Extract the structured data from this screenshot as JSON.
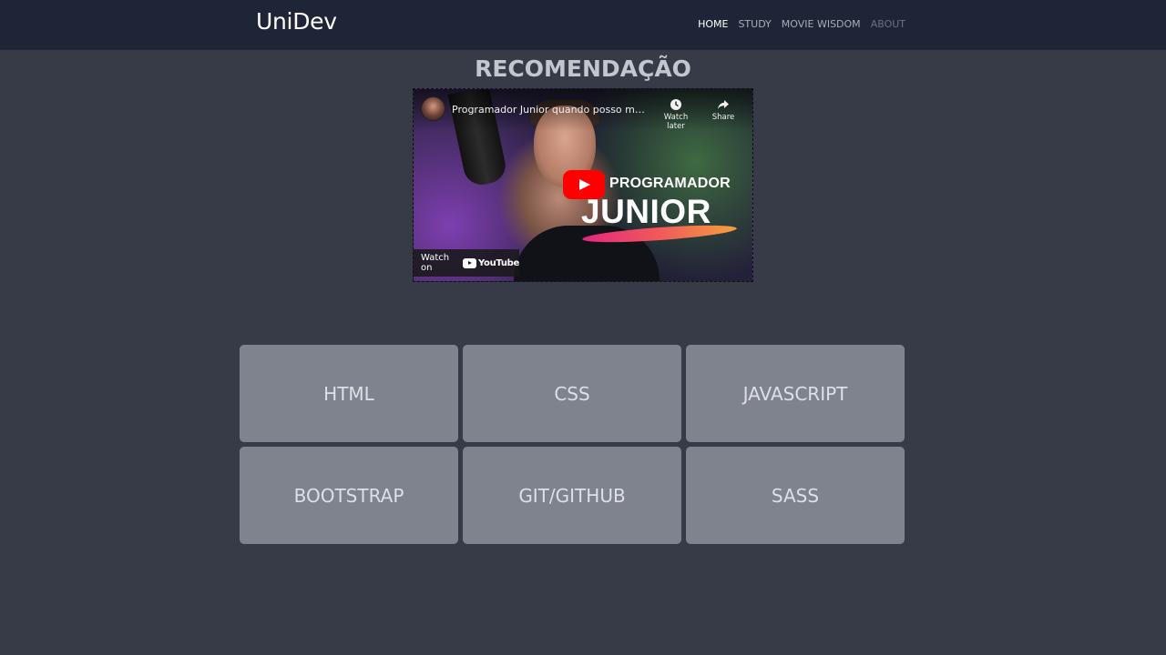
{
  "brand": "UniDev",
  "nav": {
    "items": [
      {
        "label": "HOME",
        "state": "active"
      },
      {
        "label": "STUDY",
        "state": "normal"
      },
      {
        "label": "MOVIE WISDOM",
        "state": "normal"
      },
      {
        "label": "ABOUT",
        "state": "muted"
      }
    ]
  },
  "section": {
    "title": "RECOMENDAÇÃO"
  },
  "video": {
    "title": "Programador Junior quando posso me...",
    "watch_later": "Watch later",
    "share": "Share",
    "watch_on": "Watch on",
    "youtube": "YouTube",
    "thumb_line1": "PROGRAMADOR",
    "thumb_line2": "JUNIOR"
  },
  "cards": [
    {
      "label": "HTML"
    },
    {
      "label": "CSS"
    },
    {
      "label": "JAVASCRIPT"
    },
    {
      "label": "BOOTSTRAP"
    },
    {
      "label": "GIT/GITHUB"
    },
    {
      "label": "SASS"
    }
  ],
  "colors": {
    "navbar": "#1d2536",
    "page_bg": "#363b47",
    "card_bg": "#7e838d",
    "play_button": "#ff0000"
  }
}
